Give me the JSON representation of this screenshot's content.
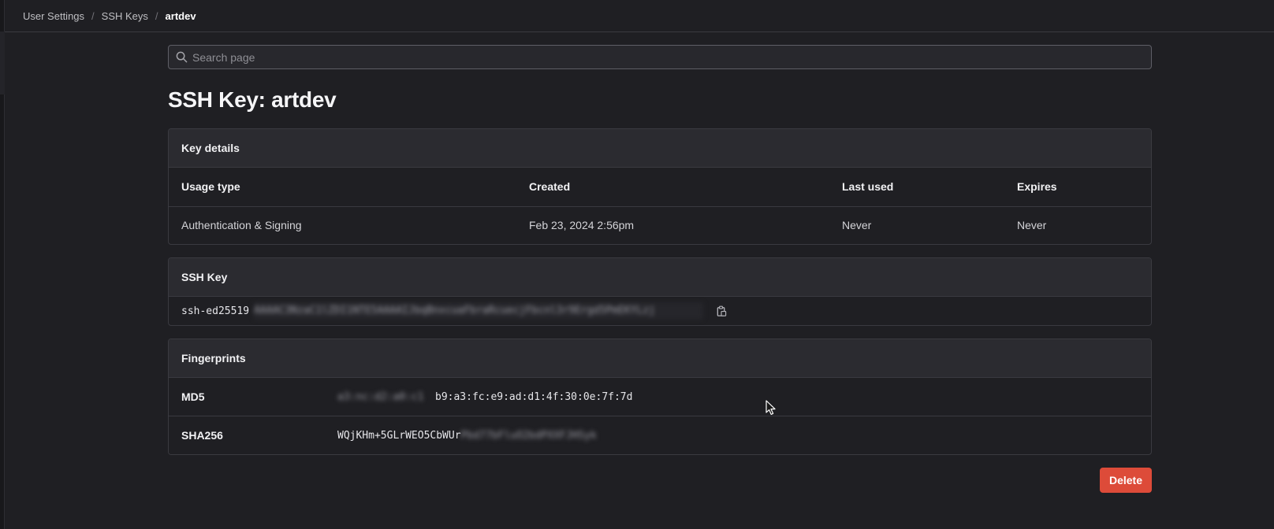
{
  "breadcrumb": {
    "items": [
      "User Settings",
      "SSH Keys"
    ],
    "current": "artdev",
    "separator": "/"
  },
  "search": {
    "placeholder": "Search page",
    "icon": "search-icon"
  },
  "page_title": "SSH Key: artdev",
  "key_details": {
    "header": "Key details",
    "columns": [
      "Usage type",
      "Created",
      "Last used",
      "Expires"
    ],
    "row": {
      "usage_type": "Authentication & Signing",
      "created": "Feb 23, 2024 2:56pm",
      "last_used": "Never",
      "expires": "Never"
    }
  },
  "ssh_key": {
    "header": "SSH Key",
    "key_type": "ssh-ed25519",
    "key_value_redacted": "AAAAC3NzaC1lZDI1NTE5AAAAIJbqBnxcuaFbraRcuecjFbcnl3r9Ergd5PmEKYLzj",
    "copy_icon": "clipboard-icon"
  },
  "fingerprints": {
    "header": "Fingerprints",
    "md5": {
      "label": "MD5",
      "redacted_prefix": "a3:nc:d2:a0:c1",
      "value": "b9:a3:fc:e9:ad:d1:4f:30:0e:7f:7d"
    },
    "sha256": {
      "label": "SHA256",
      "value": "WQjKHm+5GLrWEO5CbWUr",
      "redacted_suffix": "Pbd77bFluO2bdPXXFJHSyk"
    }
  },
  "actions": {
    "delete_label": "Delete"
  },
  "colors": {
    "background": "#1f1f23",
    "panel_header": "#2b2b30",
    "border": "#3a3a40",
    "danger": "#dd4b39"
  }
}
